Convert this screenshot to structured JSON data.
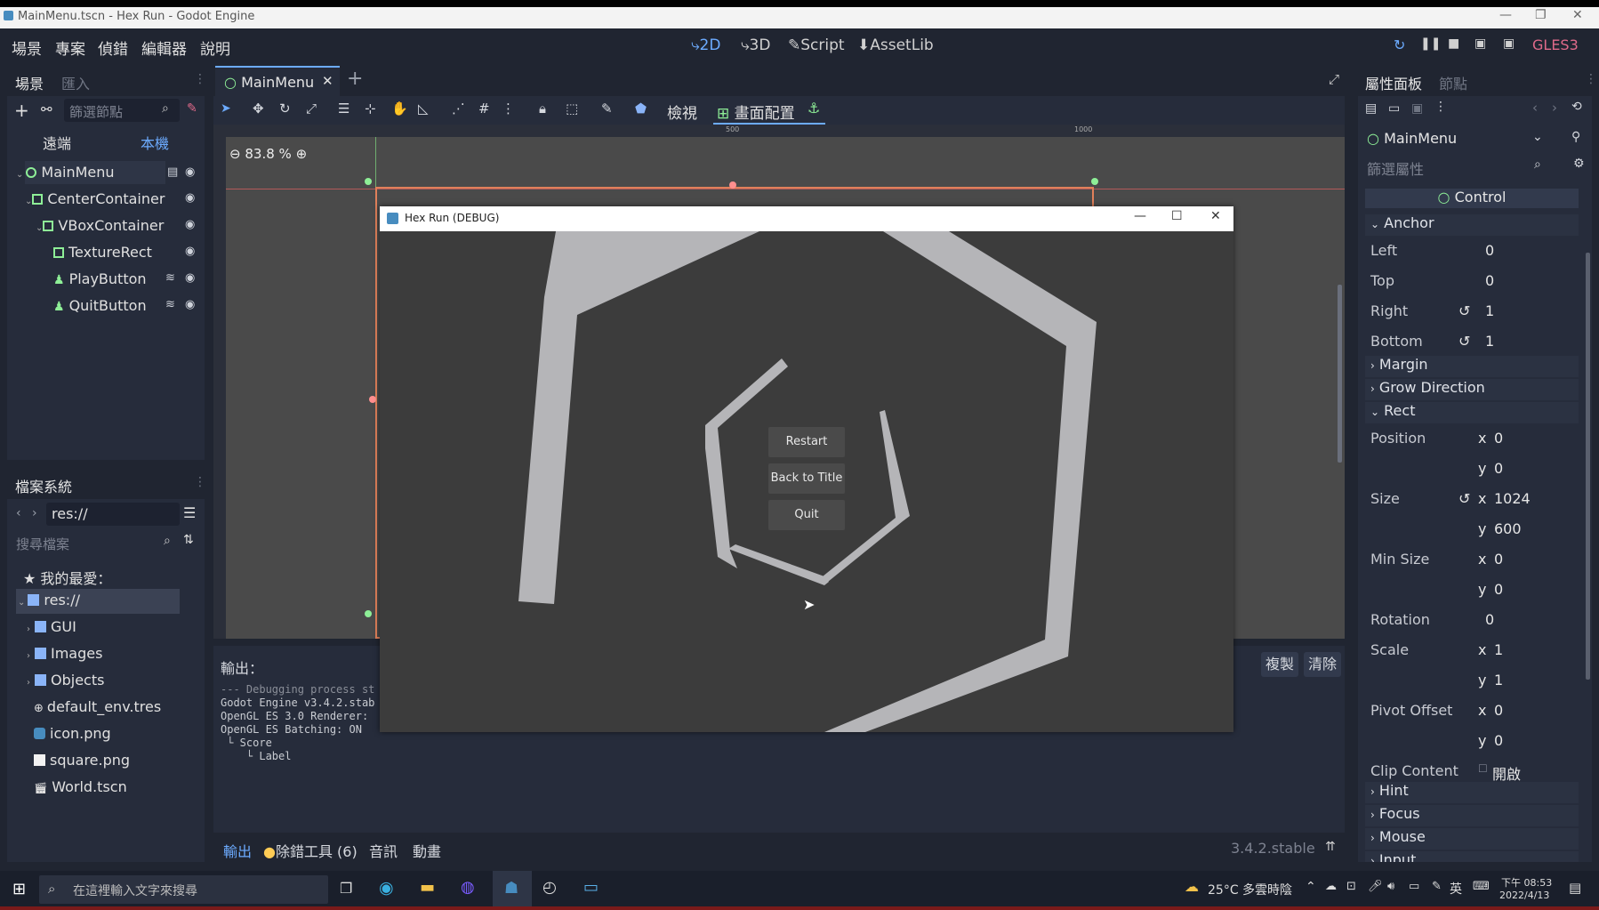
{
  "window": {
    "title": "MainMenu.tscn - Hex Run - Godot Engine"
  },
  "menu": {
    "scene": "場景",
    "project": "專案",
    "debug": "偵錯",
    "editor": "編輯器",
    "help": "說明"
  },
  "modes": {
    "m2d": "2D",
    "m3d": "3D",
    "script": "Script",
    "assetlib": "AssetLib"
  },
  "toolbar_right": {
    "renderer": "GLES3"
  },
  "scene_dock": {
    "tab_scene": "場景",
    "tab_import": "匯入",
    "filter_placeholder": "篩選節點",
    "remote": "遠端",
    "local": "本機",
    "nodes": [
      {
        "label": "MainMenu",
        "icon": "control-icon"
      },
      {
        "label": "CenterContainer",
        "icon": "center-container-icon"
      },
      {
        "label": "VBoxContainer",
        "icon": "vbox-container-icon"
      },
      {
        "label": "TextureRect",
        "icon": "texture-rect-icon"
      },
      {
        "label": "PlayButton",
        "icon": "button-icon"
      },
      {
        "label": "QuitButton",
        "icon": "button-icon"
      }
    ]
  },
  "filesystem": {
    "title": "檔案系統",
    "path": "res://",
    "search_placeholder": "搜尋檔案",
    "favorites": "我的最愛：",
    "items": [
      "res://",
      "GUI",
      "Images",
      "Objects",
      "default_env.tres",
      "icon.png",
      "square.png",
      "World.tscn"
    ]
  },
  "editor_tabs": {
    "main_menu": "MainMenu"
  },
  "viewport_toolbar": {
    "view": "檢視",
    "layout": "畫面配置"
  },
  "zoom": "83.8 %",
  "ruler": {
    "t500": "500",
    "t1000": "1000"
  },
  "game_window": {
    "title": "Hex Run (DEBUG)",
    "buttons": [
      "Restart",
      "Back to Title",
      "Quit"
    ]
  },
  "output": {
    "label": "輸出：",
    "copy": "複製",
    "clear": "清除",
    "lines": [
      "--- Debugging process st",
      "Godot Engine v3.4.2.stab",
      "OpenGL ES 3.0 Renderer:",
      "OpenGL ES Batching: ON",
      "",
      " └ Score",
      "    └ Label"
    ]
  },
  "bottom_panel": {
    "output": "輸出",
    "debugger": "除錯工具 (6)",
    "audio": "音訊",
    "animation": "動畫",
    "version": "3.4.2.stable"
  },
  "inspector": {
    "tab_inspector": "屬性面板",
    "tab_node": "節點",
    "object": "MainMenu",
    "filter_placeholder": "篩選屬性",
    "class": "Control",
    "sections": {
      "anchor": "Anchor",
      "margin": "Margin",
      "grow": "Grow Direction",
      "rect": "Rect",
      "hint": "Hint",
      "focus": "Focus",
      "mouse": "Mouse",
      "input": "Input"
    },
    "anchor": {
      "left": [
        "Left",
        "0"
      ],
      "top": [
        "Top",
        "0"
      ],
      "right": [
        "Right",
        "1"
      ],
      "bottom": [
        "Bottom",
        "1"
      ]
    },
    "rect": {
      "position": "Position",
      "pos_x": "0",
      "pos_y": "0",
      "size": "Size",
      "size_x": "1024",
      "size_y": "600",
      "min_size": "Min Size",
      "min_x": "0",
      "min_y": "0",
      "rotation": "Rotation",
      "rotation_val": "0",
      "scale": "Scale",
      "scale_x": "1",
      "scale_y": "1",
      "pivot": "Pivot Offset",
      "pivot_x": "0",
      "pivot_y": "0",
      "clip": "Clip Content",
      "clip_val": "開啟"
    },
    "x": "x",
    "y": "y"
  },
  "taskbar": {
    "search_placeholder": "在這裡輸入文字來搜尋",
    "weather": "25°C 多雲時陰",
    "ime": "英",
    "time": "下午 08:53",
    "date": "2022/4/13"
  },
  "colors": {
    "accent": "#6cabff",
    "panel": "#262c3b",
    "base": "#202531",
    "orange": "#e0805a"
  }
}
